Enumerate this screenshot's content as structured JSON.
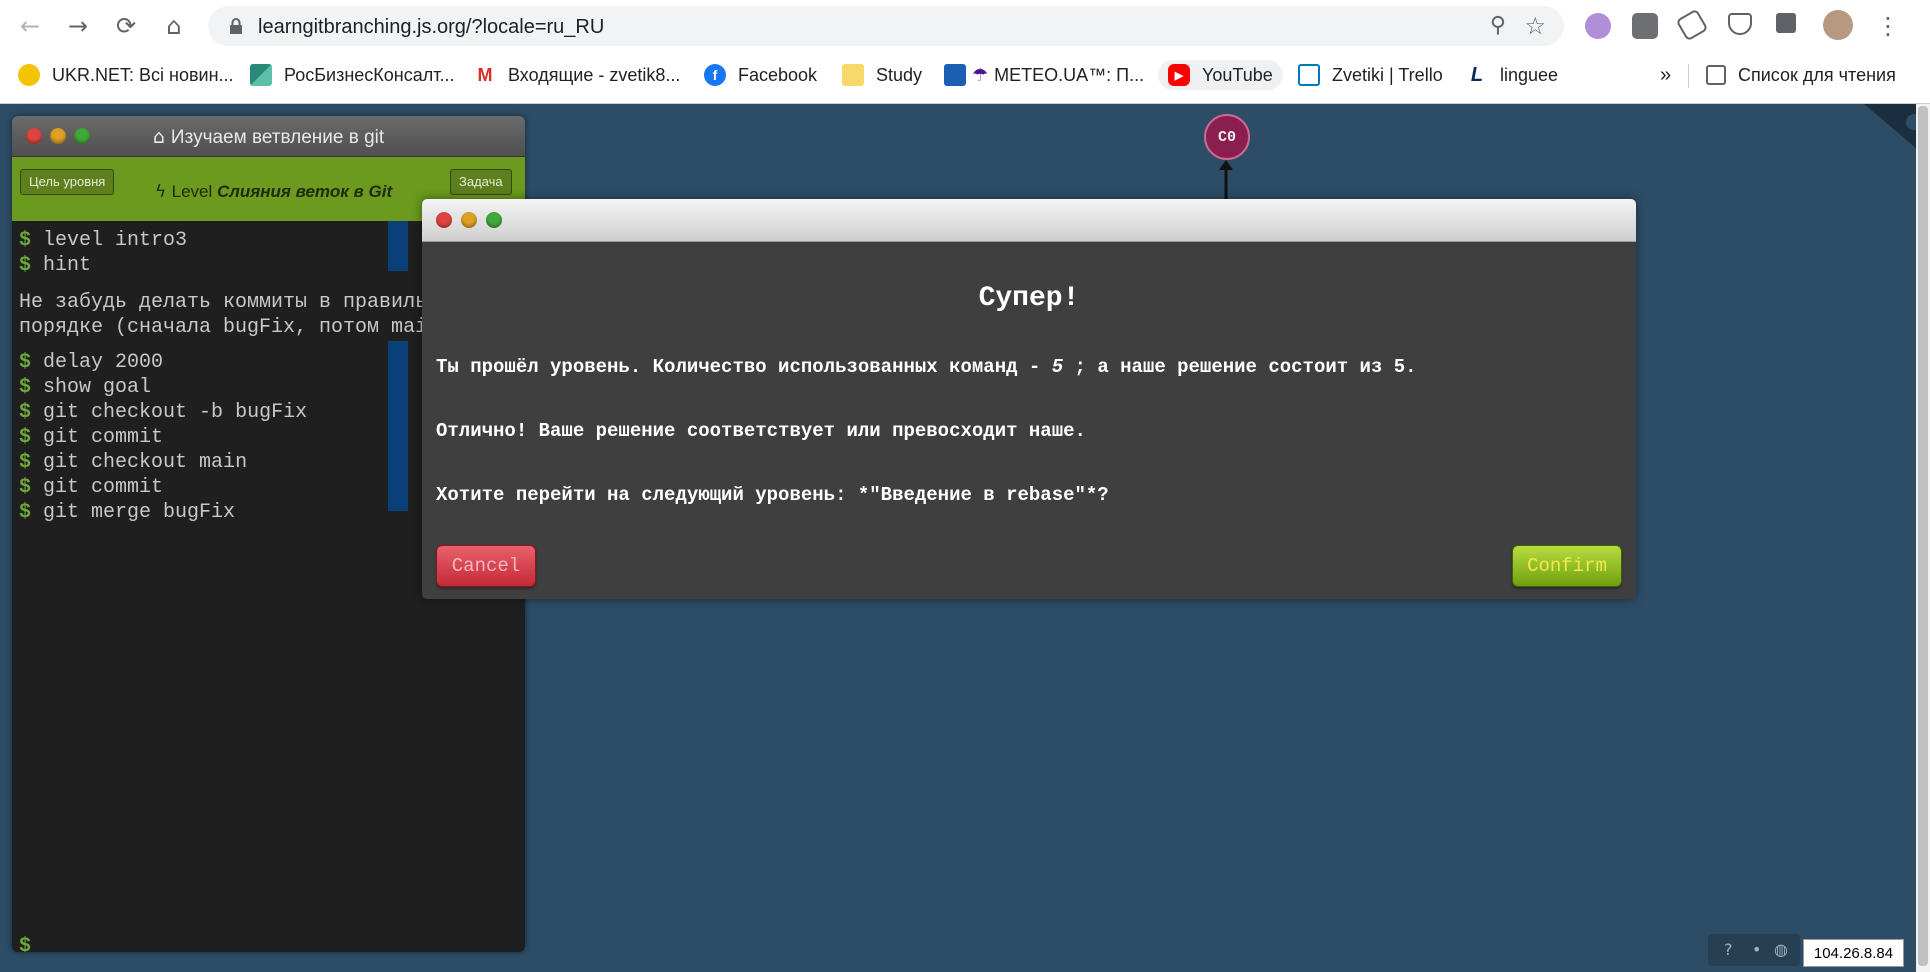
{
  "browser": {
    "url": "learngitbranching.js.org/?locale=ru_RU",
    "bookmarks": [
      {
        "label": "UKR.NET: Всі новин...",
        "icon": "ukrnet-icon"
      },
      {
        "label": "РосБизнесКонсалт...",
        "icon": "rbc-icon"
      },
      {
        "label": "Входящие - zvetik8...",
        "icon": "gmail-icon"
      },
      {
        "label": "Facebook",
        "icon": "facebook-icon"
      },
      {
        "label": "Study",
        "icon": "folder-icon"
      },
      {
        "label": "METEO.UA™: П...",
        "icon": "meteo-icon"
      },
      {
        "label": "YouTube",
        "icon": "youtube-icon"
      },
      {
        "label": "Zvetiki | Trello",
        "icon": "trello-icon"
      },
      {
        "label": "linguee",
        "icon": "linguee-icon"
      }
    ],
    "more_bookmarks": "»",
    "reading_list": "Список для чтения"
  },
  "terminal": {
    "title": "Изучаем ветвление в git",
    "goal_button": "Цель уровня",
    "task_button": "Задача",
    "level_prefix": "Level",
    "level_name": "Слияния веток в Git",
    "prompt": "$",
    "commands_top": [
      "level intro3",
      "hint"
    ],
    "hint_lines": [
      "Не забудь делать коммиты в правиль",
      "порядке (сначала bugFix, потом mai"
    ],
    "commands": [
      "delay 2000",
      "show goal",
      "git checkout -b bugFix",
      "git commit",
      "git checkout main",
      "git commit",
      "git merge bugFix"
    ]
  },
  "graph": {
    "node_label": "C0"
  },
  "modal": {
    "heading": "Супер!",
    "line1_a": "Ты прошёл уровень. Количество использованных команд - ",
    "line1_count": "5",
    "line1_b": " ; а наше решение состоит из 5.",
    "line2": "Отлично! Ваше решение соответствует или превосходит наше.",
    "line3": "Хотите перейти на следующий уровень: *\"Введение в rebase\"*?",
    "cancel": "Cancel",
    "confirm": "Confirm"
  },
  "footer": {
    "help_icon": "?",
    "dot": "•",
    "ip": "104.26.8.84"
  },
  "colors": {
    "page_bg": "#2d4d66",
    "level_bar": "#6b9a1e",
    "node": "#8a1e4f",
    "cancel": "#c42a38",
    "confirm": "#6fa010"
  }
}
